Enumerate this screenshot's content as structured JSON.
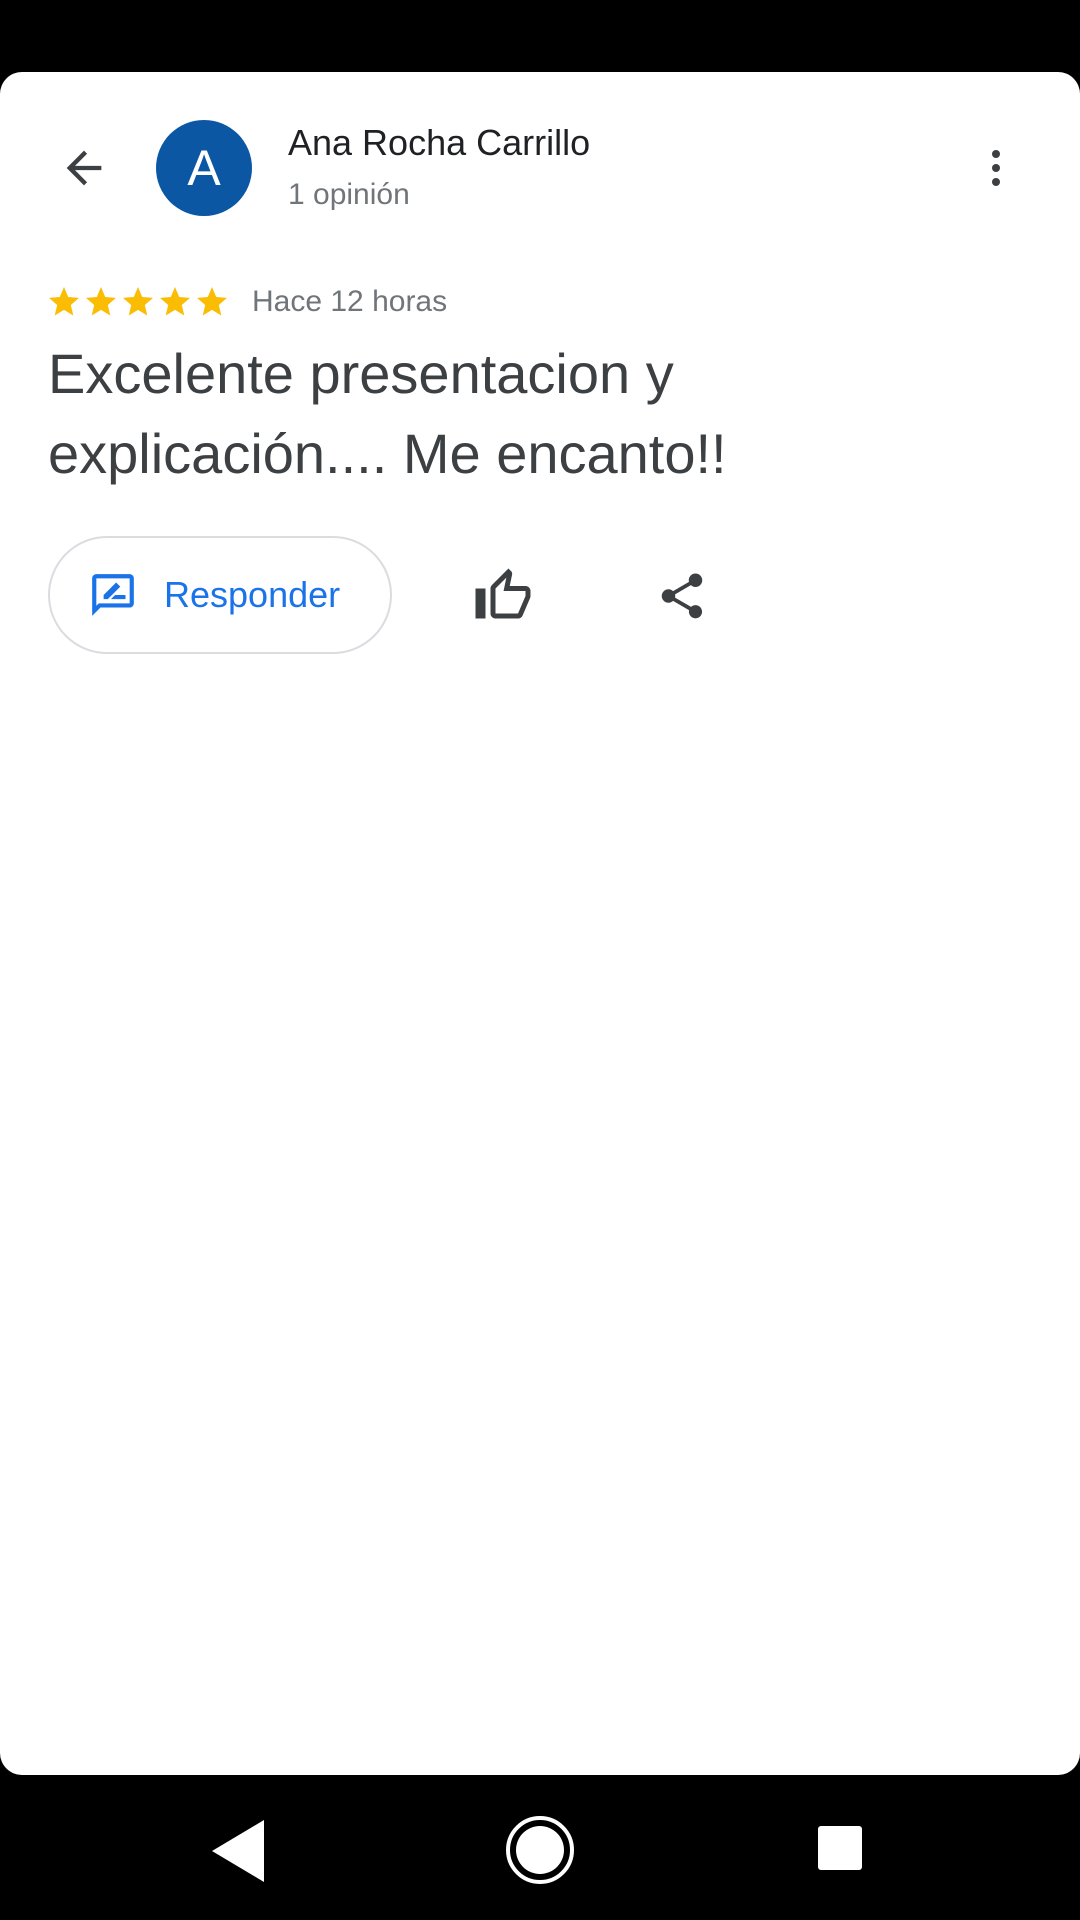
{
  "colors": {
    "avatar_bg": "#0b57a4",
    "star": "#fbbc04",
    "accent": "#1a73e8",
    "icon": "#3c4043"
  },
  "header": {
    "back_icon": "arrow-back-icon",
    "avatar_letter": "A",
    "author_name": "Ana Rocha Carrillo",
    "author_reviews": "1 opinión",
    "more_icon": "more-vert-icon"
  },
  "review": {
    "rating": 5,
    "rating_max": 5,
    "time": "Hace 12 horas",
    "text": "Excelente presentacion y explicación.... Me encanto!!"
  },
  "actions": {
    "reply_label": "Responder",
    "reply_icon": "rate-review-icon",
    "like_icon": "thumb-up-icon",
    "share_icon": "share-icon"
  },
  "system_nav": {
    "back_icon": "nav-back-icon",
    "home_icon": "nav-home-icon",
    "recents_icon": "nav-recents-icon"
  }
}
